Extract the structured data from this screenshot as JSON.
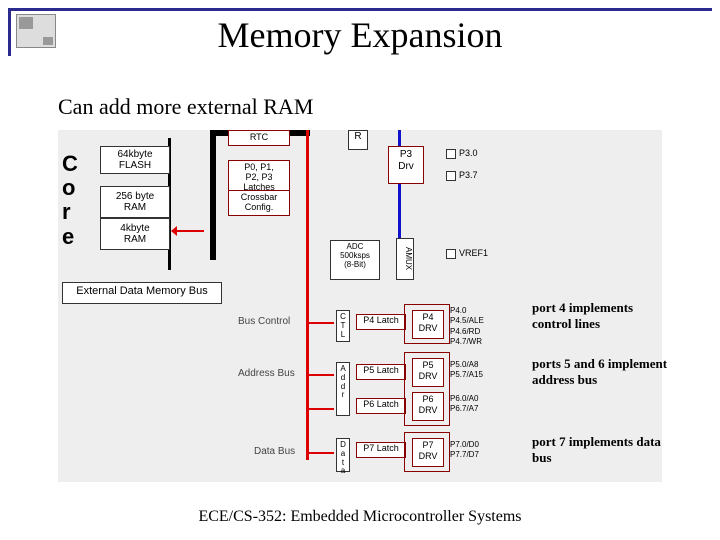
{
  "title": "Memory Expansion",
  "subtitle": "Can add more external RAM",
  "footer": "ECE/CS-352: Embedded Microcontroller Systems",
  "core_label": "C\no\nr\ne",
  "mem_blocks": {
    "flash": "64kbyte\nFLASH",
    "ram256": "256 byte\nRAM",
    "ram4k": "4kbyte\nRAM"
  },
  "ext_bus_label": "External Data Memory Bus",
  "latches": {
    "rtc": "RTC",
    "ports": "P0, P1,\nP2, P3\nLatches",
    "crossbar": "Crossbar\nConfig."
  },
  "r_box": "R",
  "p3_drv": "P3\nDrv",
  "adc": "ADC\n500ksps\n(8-Bit)",
  "amux": "AMUX",
  "pins": {
    "p30": "P3.0",
    "p37": "P3.7",
    "vref1": "VREF1"
  },
  "bus_labels": {
    "control": "Bus Control",
    "address": "Address Bus",
    "data": "Data Bus"
  },
  "ctl_boxes": {
    "ctl": "C\nT\nL",
    "addr": "A\nd\nd\nr",
    "data": "D\na\nt\na"
  },
  "port_latches": {
    "p4": "P4 Latch",
    "p5": "P5 Latch",
    "p6": "P6 Latch",
    "p7": "P7 Latch"
  },
  "port_drv": {
    "p4": "P4\nDRV",
    "p5": "P5\nDRV",
    "p6": "P6\nDRV",
    "p7": "P7\nDRV"
  },
  "port_pins": {
    "p4": "P4.0\nP4.5/ALE\nP4.6/RD\nP4.7/WR",
    "p5": "P5.0/A8\nP5.7/A15",
    "p6": "P6.0/A0\nP6.7/A7",
    "p7": "P7.0/D0\nP7.7/D7"
  },
  "annotations": {
    "a1": "port 4 implements control lines",
    "a2": "ports 5 and 6 implement address bus",
    "a3": "port 7 implements data bus"
  }
}
